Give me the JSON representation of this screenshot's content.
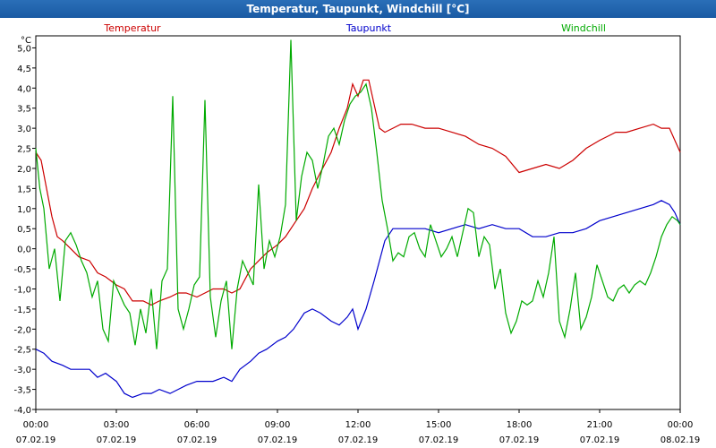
{
  "window": {
    "title": "Temperatur, Taupunkt, Windchill [°C]"
  },
  "chart_data": {
    "type": "line",
    "title": "Temperatur, Taupunkt, Windchill [°C]",
    "ylabel": "°C",
    "ylim": [
      -4.0,
      5.5
    ],
    "xlim": [
      0,
      24
    ],
    "grid": true,
    "legend_position": "top",
    "yticks": [
      "-4,0",
      "-3,5",
      "-3,0",
      "-2,5",
      "-2,0",
      "-1,5",
      "-1,0",
      "-0,5",
      "0,0",
      "0,5",
      "1,0",
      "1,5",
      "2,0",
      "2,5",
      "3,0",
      "3,5",
      "4,0",
      "4,5",
      "5,0"
    ],
    "ytick_values": [
      -4.0,
      -3.5,
      -3.0,
      -2.5,
      -2.0,
      -1.5,
      -1.0,
      -0.5,
      0.0,
      0.5,
      1.0,
      1.5,
      2.0,
      2.5,
      3.0,
      3.5,
      4.0,
      4.5,
      5.0
    ],
    "xticks": [
      {
        "h": 0,
        "time": "00:00",
        "date": "07.02.19"
      },
      {
        "h": 3,
        "time": "03:00",
        "date": "07.02.19"
      },
      {
        "h": 6,
        "time": "06:00",
        "date": "07.02.19"
      },
      {
        "h": 9,
        "time": "09:00",
        "date": "07.02.19"
      },
      {
        "h": 12,
        "time": "12:00",
        "date": "07.02.19"
      },
      {
        "h": 15,
        "time": "15:00",
        "date": "07.02.19"
      },
      {
        "h": 18,
        "time": "18:00",
        "date": "07.02.19"
      },
      {
        "h": 21,
        "time": "21:00",
        "date": "07.02.19"
      },
      {
        "h": 24,
        "time": "00:00",
        "date": "08.02.19"
      }
    ],
    "series": [
      {
        "name": "Temperatur",
        "color": "#cc0000",
        "x": [
          0,
          0.2,
          0.4,
          0.6,
          0.8,
          1.0,
          1.3,
          1.6,
          2.0,
          2.3,
          2.6,
          3.0,
          3.3,
          3.6,
          4.0,
          4.3,
          4.6,
          5.0,
          5.3,
          5.6,
          6.0,
          6.3,
          6.6,
          7.0,
          7.3,
          7.6,
          8.0,
          8.3,
          8.6,
          9.0,
          9.3,
          9.6,
          10.0,
          10.3,
          10.6,
          11.0,
          11.3,
          11.6,
          11.8,
          12.0,
          12.2,
          12.4,
          12.6,
          12.8,
          13.0,
          13.3,
          13.6,
          14.0,
          14.5,
          15.0,
          15.5,
          16.0,
          16.5,
          17.0,
          17.5,
          18.0,
          18.5,
          19.0,
          19.5,
          20.0,
          20.5,
          21.0,
          21.3,
          21.6,
          22.0,
          22.5,
          23.0,
          23.3,
          23.6,
          23.8,
          24.0
        ],
        "y": [
          2.4,
          2.2,
          1.5,
          0.8,
          0.3,
          0.2,
          0.0,
          -0.2,
          -0.3,
          -0.6,
          -0.7,
          -0.9,
          -1.0,
          -1.3,
          -1.3,
          -1.4,
          -1.3,
          -1.2,
          -1.1,
          -1.1,
          -1.2,
          -1.1,
          -1.0,
          -1.0,
          -1.1,
          -1.0,
          -0.5,
          -0.3,
          -0.1,
          0.1,
          0.3,
          0.6,
          1.0,
          1.5,
          1.9,
          2.4,
          3.0,
          3.5,
          4.1,
          3.8,
          4.2,
          4.2,
          3.6,
          3.0,
          2.9,
          3.0,
          3.1,
          3.1,
          3.0,
          3.0,
          2.9,
          2.8,
          2.6,
          2.5,
          2.3,
          1.9,
          2.0,
          2.1,
          2.0,
          2.2,
          2.5,
          2.7,
          2.8,
          2.9,
          2.9,
          3.0,
          3.1,
          3.0,
          3.0,
          2.7,
          2.4
        ]
      },
      {
        "name": "Taupunkt",
        "color": "#0000cc",
        "x": [
          0,
          0.3,
          0.6,
          1.0,
          1.3,
          1.6,
          2.0,
          2.3,
          2.6,
          3.0,
          3.3,
          3.6,
          4.0,
          4.3,
          4.6,
          5.0,
          5.3,
          5.6,
          6.0,
          6.3,
          6.6,
          7.0,
          7.3,
          7.6,
          8.0,
          8.3,
          8.6,
          9.0,
          9.3,
          9.6,
          10.0,
          10.3,
          10.6,
          11.0,
          11.3,
          11.6,
          11.8,
          12.0,
          12.3,
          12.6,
          12.8,
          13.0,
          13.3,
          13.6,
          14.0,
          14.5,
          15.0,
          15.5,
          16.0,
          16.5,
          17.0,
          17.5,
          18.0,
          18.5,
          19.0,
          19.5,
          20.0,
          20.5,
          21.0,
          21.5,
          22.0,
          22.5,
          23.0,
          23.3,
          23.6,
          23.8,
          24.0
        ],
        "y": [
          -2.5,
          -2.6,
          -2.8,
          -2.9,
          -3.0,
          -3.0,
          -3.0,
          -3.2,
          -3.1,
          -3.3,
          -3.6,
          -3.7,
          -3.6,
          -3.6,
          -3.5,
          -3.6,
          -3.5,
          -3.4,
          -3.3,
          -3.3,
          -3.3,
          -3.2,
          -3.3,
          -3.0,
          -2.8,
          -2.6,
          -2.5,
          -2.3,
          -2.2,
          -2.0,
          -1.6,
          -1.5,
          -1.6,
          -1.8,
          -1.9,
          -1.7,
          -1.5,
          -2.0,
          -1.5,
          -0.8,
          -0.3,
          0.2,
          0.5,
          0.5,
          0.5,
          0.5,
          0.4,
          0.5,
          0.6,
          0.5,
          0.6,
          0.5,
          0.5,
          0.3,
          0.3,
          0.4,
          0.4,
          0.5,
          0.7,
          0.8,
          0.9,
          1.0,
          1.1,
          1.2,
          1.1,
          0.9,
          0.6
        ]
      },
      {
        "name": "Windchill",
        "color": "#00aa00",
        "x": [
          0,
          0.15,
          0.3,
          0.5,
          0.7,
          0.9,
          1.1,
          1.3,
          1.5,
          1.7,
          1.9,
          2.1,
          2.3,
          2.5,
          2.7,
          2.9,
          3.1,
          3.3,
          3.5,
          3.7,
          3.9,
          4.1,
          4.3,
          4.5,
          4.7,
          4.9,
          5.1,
          5.3,
          5.5,
          5.7,
          5.9,
          6.1,
          6.3,
          6.5,
          6.7,
          6.9,
          7.1,
          7.3,
          7.5,
          7.7,
          7.9,
          8.1,
          8.3,
          8.5,
          8.7,
          8.9,
          9.1,
          9.3,
          9.5,
          9.7,
          9.9,
          10.1,
          10.3,
          10.5,
          10.7,
          10.9,
          11.1,
          11.3,
          11.5,
          11.7,
          11.9,
          12.1,
          12.3,
          12.5,
          12.7,
          12.9,
          13.1,
          13.3,
          13.5,
          13.7,
          13.9,
          14.1,
          14.3,
          14.5,
          14.7,
          14.9,
          15.1,
          15.3,
          15.5,
          15.7,
          15.9,
          16.1,
          16.3,
          16.5,
          16.7,
          16.9,
          17.1,
          17.3,
          17.5,
          17.7,
          17.9,
          18.1,
          18.3,
          18.5,
          18.7,
          18.9,
          19.1,
          19.3,
          19.5,
          19.7,
          19.9,
          20.1,
          20.3,
          20.5,
          20.7,
          20.9,
          21.1,
          21.3,
          21.5,
          21.7,
          21.9,
          22.1,
          22.3,
          22.5,
          22.7,
          22.9,
          23.1,
          23.3,
          23.5,
          23.7,
          23.9,
          24.0
        ],
        "y": [
          2.5,
          1.5,
          1.0,
          -0.5,
          0.0,
          -1.3,
          0.2,
          0.4,
          0.1,
          -0.3,
          -0.6,
          -1.2,
          -0.8,
          -2.0,
          -2.3,
          -0.8,
          -1.1,
          -1.4,
          -1.6,
          -2.4,
          -1.5,
          -2.1,
          -1.0,
          -2.5,
          -0.8,
          -0.5,
          3.8,
          -1.5,
          -2.0,
          -1.5,
          -0.9,
          -0.7,
          3.7,
          -1.2,
          -2.2,
          -1.3,
          -0.8,
          -2.5,
          -1.0,
          -0.3,
          -0.6,
          -0.9,
          1.6,
          -0.5,
          0.2,
          -0.2,
          0.3,
          1.1,
          5.2,
          0.7,
          1.8,
          2.4,
          2.2,
          1.5,
          2.1,
          2.8,
          3.0,
          2.6,
          3.2,
          3.6,
          3.8,
          3.9,
          4.1,
          3.5,
          2.4,
          1.2,
          0.5,
          -0.3,
          -0.1,
          -0.2,
          0.3,
          0.4,
          0.0,
          -0.2,
          0.6,
          0.2,
          -0.2,
          0.0,
          0.3,
          -0.2,
          0.4,
          1.0,
          0.9,
          -0.2,
          0.3,
          0.1,
          -1.0,
          -0.5,
          -1.6,
          -2.1,
          -1.8,
          -1.3,
          -1.4,
          -1.3,
          -0.8,
          -1.2,
          -0.6,
          0.3,
          -1.8,
          -2.2,
          -1.5,
          -0.6,
          -2.0,
          -1.7,
          -1.2,
          -0.4,
          -0.8,
          -1.2,
          -1.3,
          -1.0,
          -0.9,
          -1.1,
          -0.9,
          -0.8,
          -0.9,
          -0.6,
          -0.2,
          0.3,
          0.6,
          0.8,
          0.7,
          0.6
        ]
      }
    ]
  }
}
